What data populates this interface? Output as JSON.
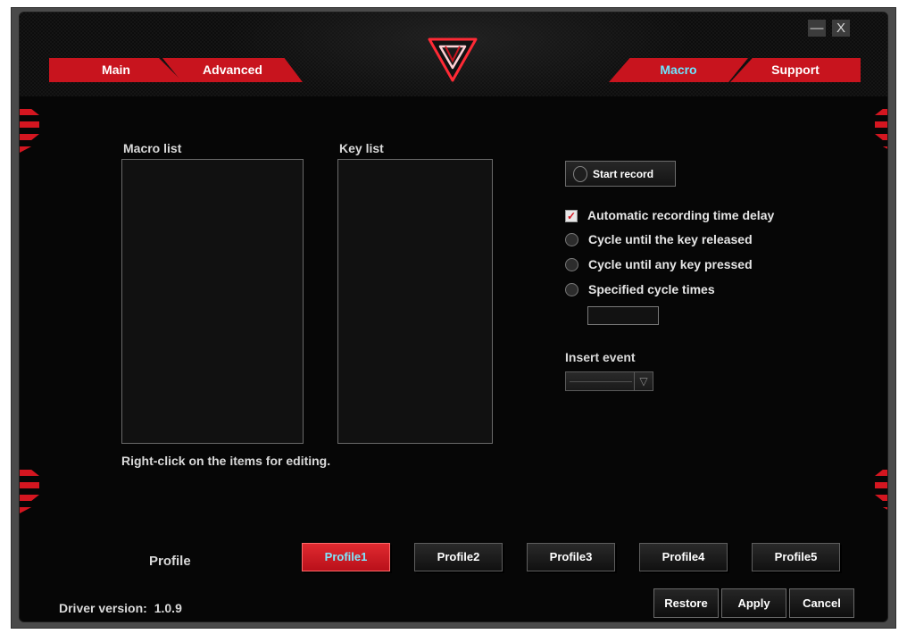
{
  "window_controls": {
    "minimize": "—",
    "close": "X"
  },
  "tabs": [
    {
      "label": "Main",
      "active": false
    },
    {
      "label": "Advanced",
      "active": false
    },
    {
      "label": "Macro",
      "active": true
    },
    {
      "label": "Support",
      "active": false
    }
  ],
  "colors": {
    "accent_red": "#c8141e",
    "active_text": "#6de6ff",
    "background": "#060606"
  },
  "macro": {
    "macro_list_label": "Macro list",
    "key_list_label": "Key list",
    "hint": "Right-click on the items for editing.",
    "start_record_label": "Start record",
    "options": [
      {
        "type": "checkbox",
        "label": "Automatic recording time delay",
        "checked": true
      },
      {
        "type": "radio",
        "label": "Cycle until the key released",
        "checked": false
      },
      {
        "type": "radio",
        "label": "Cycle until any key pressed",
        "checked": false
      },
      {
        "type": "radio",
        "label": "Specified cycle times",
        "checked": false
      }
    ],
    "cycle_times_value": "",
    "insert_event_label": "Insert event",
    "insert_event_value": ""
  },
  "profile": {
    "label": "Profile",
    "buttons": [
      {
        "label": "Profile1",
        "active": true
      },
      {
        "label": "Profile2",
        "active": false
      },
      {
        "label": "Profile3",
        "active": false
      },
      {
        "label": "Profile4",
        "active": false
      },
      {
        "label": "Profile5",
        "active": false
      }
    ]
  },
  "footer": {
    "driver_version_label": "Driver version:",
    "driver_version": "1.0.9",
    "restore_label": "Restore",
    "apply_label": "Apply",
    "cancel_label": "Cancel"
  }
}
